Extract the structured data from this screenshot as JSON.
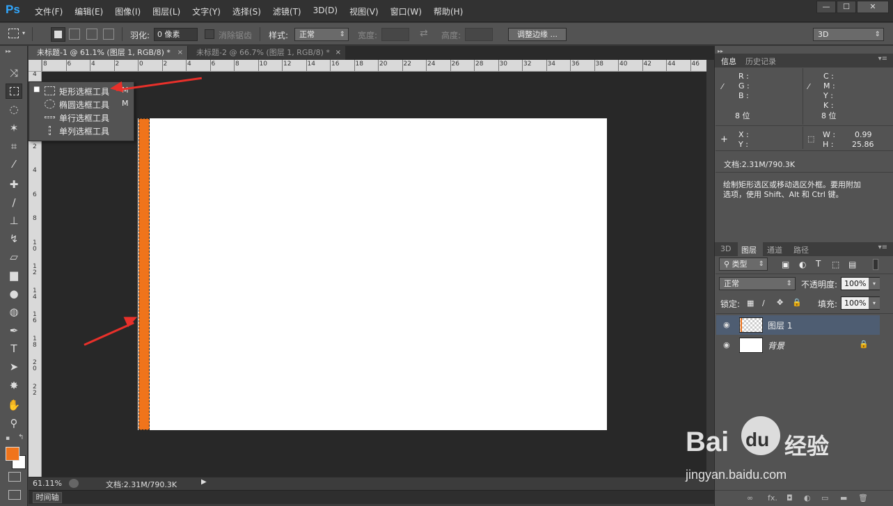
{
  "app": {
    "logo": "Ps"
  },
  "menu": [
    "文件(F)",
    "编辑(E)",
    "图像(I)",
    "图层(L)",
    "文字(Y)",
    "选择(S)",
    "滤镜(T)",
    "3D(D)",
    "视图(V)",
    "窗口(W)",
    "帮助(H)"
  ],
  "window_controls": {
    "minimize": "—",
    "restore": "☐",
    "close": "✕"
  },
  "options": {
    "feather_label": "羽化:",
    "feather_value": "0 像素",
    "antialias_label": "消除锯齿",
    "style_label": "样式:",
    "style_value": "正常",
    "width_label": "宽度:",
    "height_label": "高度:",
    "refine_edge": "调整边缘 ...",
    "workspace": "3D"
  },
  "tabs": [
    {
      "title": "未标题-1 @ 61.1% (图层 1, RGB/8) *",
      "close": "×"
    },
    {
      "title": "未标题-2 @ 66.7% (图层 1, RGB/8) *",
      "close": "×"
    }
  ],
  "ruler": {
    "h": [
      "8",
      "6",
      "4",
      "2",
      "0",
      "2",
      "4",
      "6",
      "8",
      "10",
      "12",
      "14",
      "16",
      "18",
      "20",
      "22",
      "24",
      "26",
      "28",
      "30",
      "32",
      "34",
      "36",
      "38",
      "40",
      "42",
      "44",
      "46"
    ],
    "v": [
      "4",
      "2",
      "0",
      "2",
      "4",
      "6",
      "8",
      "1\n0",
      "1\n2",
      "1\n4",
      "1\n6",
      "1\n8",
      "2\n0",
      "2\n2"
    ]
  },
  "tool_popup": {
    "items": [
      {
        "label": "矩形选框工具",
        "key": "M",
        "selected": true
      },
      {
        "label": "椭圆选框工具",
        "key": "M",
        "selected": false
      },
      {
        "label": "单行选框工具",
        "key": "",
        "selected": false
      },
      {
        "label": "单列选框工具",
        "key": "",
        "selected": false
      }
    ]
  },
  "status": {
    "zoom": "61.11%",
    "doc": "文档:2.31M/790.3K",
    "timeline": "时间轴"
  },
  "info_panel": {
    "tabs": [
      "信息",
      "历史记录"
    ],
    "rgb": [
      "R :",
      "G :",
      "B :"
    ],
    "cmyk": [
      "C :",
      "M :",
      "Y :",
      "K :"
    ],
    "bits_left": "8 位",
    "bits_right": "8 位",
    "xy": [
      "X :",
      "Y :"
    ],
    "wh_labels": [
      "W :",
      "H :"
    ],
    "w_value": "0.99",
    "h_value": "25.86",
    "doc": "文档:2.31M/790.3K",
    "hint_line1": "绘制矩形选区或移动选区外框。要用附加",
    "hint_line2": "选项，使用 Shift、Alt 和 Ctrl 键。"
  },
  "layers_panel": {
    "tabs": [
      "3D",
      "图层",
      "通道",
      "路径"
    ],
    "filter_kind": "类型",
    "blend_mode": "正常",
    "opacity_label": "不透明度:",
    "opacity_value": "100%",
    "lock_label": "锁定:",
    "fill_label": "填充:",
    "fill_value": "100%",
    "layers": [
      {
        "name": "图层 1",
        "selected": true
      },
      {
        "name": "背景",
        "locked": true
      }
    ],
    "footer_icons": [
      "∞",
      "fx.",
      "◘",
      "◐",
      "▭",
      "▬",
      "🗑"
    ]
  },
  "watermark": {
    "brand": "Bai",
    "brand2": "du",
    "cn": "经验",
    "url": "jingyan.baidu.com"
  },
  "colors": {
    "foreground": "#f0741b",
    "background": "#ffffff",
    "selection_fill": "#f0741b",
    "arrow": "#e8302a"
  }
}
